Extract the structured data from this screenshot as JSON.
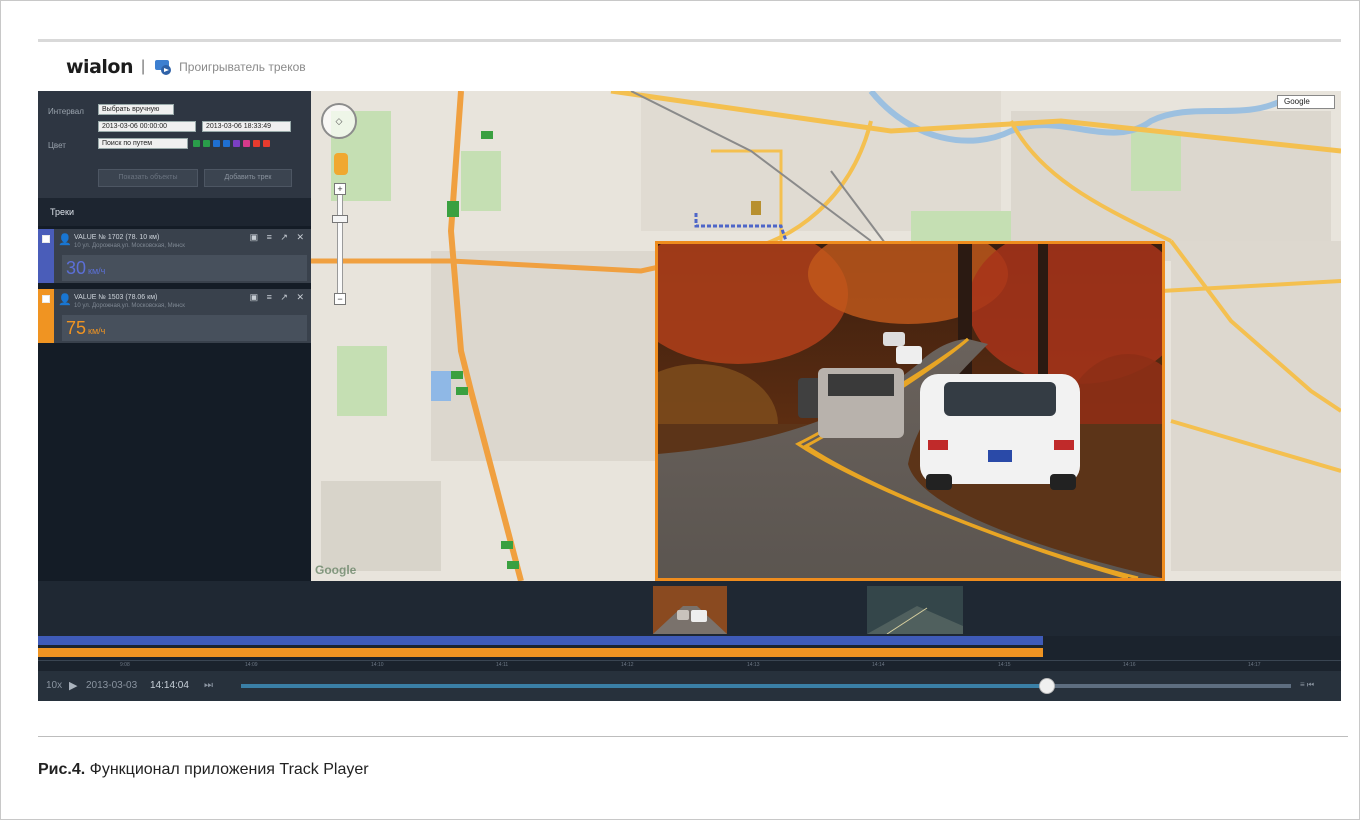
{
  "header": {
    "logo_text": "wialon",
    "separator": "|",
    "app_title": "Проигрыватель треков"
  },
  "controls": {
    "interval_label": "Интервал",
    "interval_value": "Выбрать вручную",
    "date_from": "2013-03-06 00:00:00",
    "date_to": "2013-03-06 18:33:49",
    "color_label": "Цвет",
    "color_value": "Поиск по путем",
    "color_swatches": [
      "#2a9d4a",
      "#2a9d4a",
      "#1f6fd1",
      "#1f6fd1",
      "#7a3fc2",
      "#d63a8a",
      "#e63b2e",
      "#e63b2e"
    ],
    "btn_show": "Показать объекты",
    "btn_add": "Добавить трек"
  },
  "tracks": {
    "title": "Треки",
    "items": [
      {
        "name": "VALUE № 1702 (78. 10 км)",
        "address": "10 ул. Дорожная,ул. Московская, Минск",
        "speed": "30",
        "unit": "км/ч",
        "color": "#4a5db9",
        "tools": "▣ ≡ ↗ ✕"
      },
      {
        "name": "VALUE № 1503 (78.06 км)",
        "address": "10 ул. Дорожная,ул. Московская, Минск",
        "speed": "75",
        "unit": "км/ч",
        "color": "#f09422",
        "tools": "▣ ≡ ↗ ✕"
      }
    ]
  },
  "map": {
    "map_type": "Google",
    "attribution": "Google",
    "zoom_in": "+",
    "zoom_out": "−"
  },
  "timeline": {
    "tick_labels": [
      "9:08",
      "14:09",
      "14:10",
      "14:11",
      "14:12",
      "14:13",
      "14:14",
      "14:15",
      "14:16",
      "14:17"
    ],
    "speed_multiplier": "10x",
    "play_icon": "▶",
    "date": "2013-03-03",
    "time": "14:14:04",
    "step_icon": "⏭",
    "right_controls": "≡ ⏮"
  },
  "caption": {
    "label": "Рис.4.",
    "text": " Функционал приложения Track Player"
  }
}
